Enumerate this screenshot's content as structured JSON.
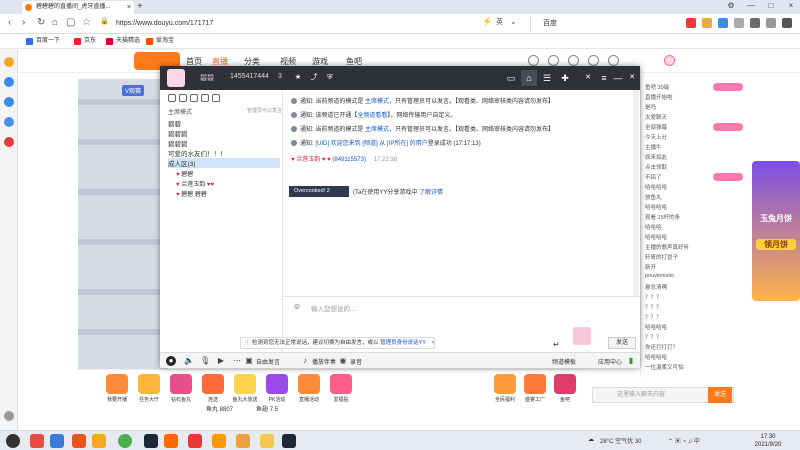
{
  "browser": {
    "tab_title": "碧碧碧的直播间_虎牙直播...",
    "url": "https://www.douyu.com/171717",
    "search_engine": "百度",
    "bookmarks": [
      "百度一下",
      "京东",
      "天猫精选",
      "爱淘宝"
    ]
  },
  "site": {
    "nav": [
      "首页",
      "直播",
      "分类",
      "视频",
      "游戏",
      "鱼吧"
    ],
    "active_nav": "直播",
    "stream_tag": "V观赛",
    "fishball_label": "鱼吧",
    "sidechat_lines": [
      "鱼吧 30级",
      "直播开始啦",
      "是吗",
      "太爱聊天",
      "全部弹幕",
      "今天上分",
      "主播牛",
      "原来如此",
      "点击领取",
      "不搞了",
      "哈哈哈哈",
      "放鱼丸",
      "哈哈哈哈",
      "观看 15杆的条",
      "哈哈哈",
      "哈哈哈哈",
      "主播的歌声真好听",
      "轩哥的打冒子",
      "新开",
      "pouvlenistio",
      "悬念清嗍",
      "？？？",
      "？？？",
      "？？？",
      "哈哈哈哈",
      "？？？",
      "你还打打打？",
      "哈哈哈哈",
      "一位温柔又可怕",
      "66666",
      "哈哈哈哈",
      "哈哈哈哈",
      "哈哈哈哈"
    ],
    "banner_text": "玉兔月饼",
    "banner_sub": "领月饼",
    "chat_input_placeholder": "这里输入聊天内容",
    "send_label": "发送",
    "gifts": [
      "我要开播",
      "任务大厅",
      "钻石鱼丸",
      "连送",
      "鱼丸大放送",
      "PK活动",
      "直播活动",
      "爱福贴",
      "全民福利",
      "盛宴工厂",
      "鱼吧",
      "超级月饼"
    ],
    "footer_counts": [
      "鱼丸 8807",
      "鱼翅 7.5"
    ]
  },
  "yy": {
    "room_name": "碧碧",
    "room_id": "1455417444",
    "member_count": "3",
    "mode_label": "主席模式",
    "manage_label": "管理员可以发言",
    "tree": [
      {
        "label": "碧碧",
        "sel": false
      },
      {
        "label": "碧碧碧",
        "sel": false
      },
      {
        "label": "碧碧碧",
        "sel": false
      },
      {
        "label": "可爱的水友们！！！",
        "sel": false
      },
      {
        "label": "成人区(3)",
        "sel": true
      }
    ],
    "users": [
      "碧碧",
      "兰莲玉韵",
      "碧碧 碧碧"
    ],
    "notices": [
      {
        "prefix": "通知: 当前频道的模式是 ",
        "hl": "主席模式",
        "suffix": "，只有管理员可以发言。【观看类、网络审核类内容请勿发布】"
      },
      {
        "prefix": "通知: 该频道已开通【",
        "hl": "全频道看看",
        "suffix": "】，网络传输用户自定义。"
      },
      {
        "prefix": "通知: 当前频道的模式是 ",
        "hl": "主席模式",
        "suffix": "，只有管理员可以发言。【观看类、网络审核类内容请勿发布】"
      },
      {
        "prefix": "通知: ",
        "hl": "[UID] 欢迎您来到 [频道] 从 [IP所在] 的用户",
        "suffix": "登录成功 (17:17:13)"
      }
    ],
    "chat_user": "兰莲玉韵",
    "chat_uid": "(849115573)",
    "chat_time": "17:22:38",
    "tooltip": "Overcooked! 2",
    "after_tooltip_prefix": "(Ta在使用YY分享游戏中",
    "after_tooltip_hl": "了解详情",
    "input_placeholder": "输入您想说的...",
    "warn_prefix": "检测到您无法正常说话，建议切换为自由发言，或以 ",
    "warn_hl": "管理员身份说话YY",
    "bottom": [
      "自由发言",
      "播放伴奏",
      "录音",
      "频道模板",
      "应用中心"
    ],
    "send_label": "发送"
  },
  "taskbar": {
    "weather": "28°C 空气优 30",
    "time": "17:30",
    "date": "2021/9/20"
  }
}
